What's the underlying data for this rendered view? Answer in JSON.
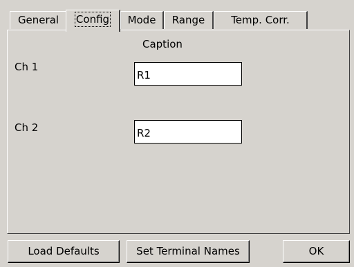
{
  "tabs": [
    {
      "label": "General"
    },
    {
      "label": "Config",
      "active": true
    },
    {
      "label": "Mode"
    },
    {
      "label": "Range"
    },
    {
      "label": "Temp. Corr."
    }
  ],
  "config": {
    "caption_header": "Caption",
    "channels": [
      {
        "label": "Ch 1",
        "caption": "R1"
      },
      {
        "label": "Ch 2",
        "caption": "R2"
      }
    ]
  },
  "buttons": {
    "load_defaults": "Load Defaults",
    "set_terminal_names": "Set Terminal Names",
    "ok": "OK"
  }
}
